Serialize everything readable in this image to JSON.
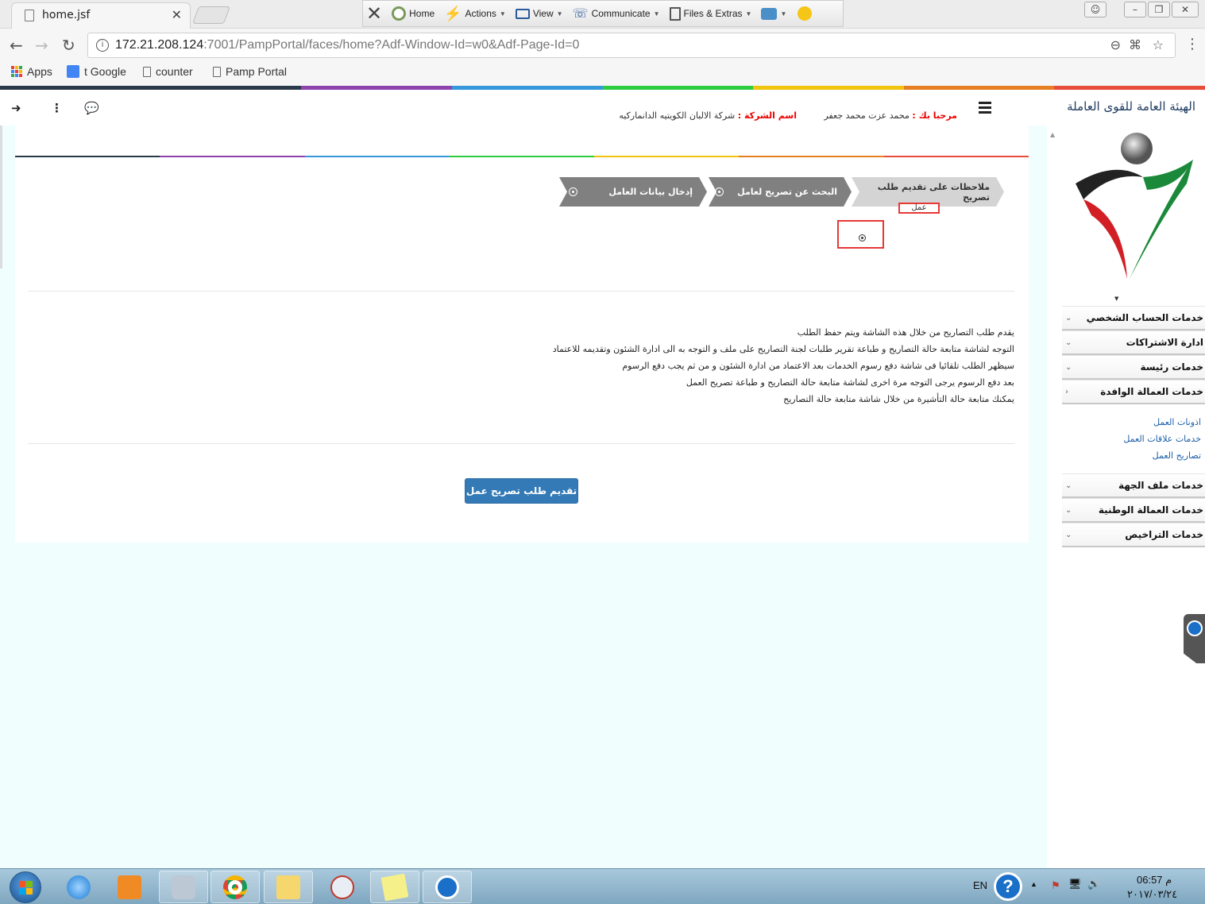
{
  "browser": {
    "tab_title": "home.jsf",
    "url_host": "172.21.208.124",
    "url_path": ":7001/PampPortal/faces/home?Adf-Window-Id=w0&Adf-Page-Id=0",
    "bookmarks": [
      "Apps",
      "t Google",
      "counter",
      "Pamp Portal"
    ]
  },
  "teamviewer": {
    "items": [
      "Home",
      "Actions",
      "View",
      "Communicate",
      "Files & Extras"
    ]
  },
  "header": {
    "welcome_label": "مرحبا بك :",
    "welcome_name": "محمد عزت محمد جعفر",
    "company_label": "اسم الشركة :",
    "company_name": "شركة الالبان الكويتيه الدانماركيه"
  },
  "sidebar": {
    "org_title": "الهيئة العامة للقوى العاملة",
    "menu_top": [
      "خدمات الحساب الشخصي",
      "ادارة الاشتراكات",
      "خدمات رئيسة",
      "خدمات العمالة الوافدة"
    ],
    "submenu": [
      "اذونات العمل",
      "خدمات علاقات العمل",
      "تصاريح العمل"
    ],
    "menu_bottom": [
      "خدمات ملف الجهة",
      "خدمات العمالة الوطنية",
      "خدمات التراخيص"
    ]
  },
  "steps": {
    "step1": "ملاحظات على تقديم طلب تصريح",
    "step1_sub": "عمل",
    "step2": "البحث عن تصريح لعامل",
    "step3": "إدخال بيانات العامل"
  },
  "notes": [
    "يقدم طلب التصاريح من خلال هذه الشاشة ويتم حفظ الطلب",
    "التوجه لشاشة متابعة حالة التصاريح و طباعة تقرير طلبات لجنة التصاريح على ملف و التوجه به الى ادارة الشئون وتقديمه للاعتماد",
    "سيظهر الطلب تلقائيا فى شاشة دفع رسوم الخدمات بعد الاعتماد من ادارة الشئون و من ثم يجب دفع الرسوم",
    "بعد دفع الرسوم يرجى التوجه مرة اخرى لشاشة متابعة حالة التصاريح و طباعة تصريح العمل",
    "يمكنك متابعة حالة التأشيرة من خلال شاشة متابعة حالة التصاريح"
  ],
  "submit_label": "تقديم طلب تصريح عمل",
  "tray": {
    "lang": "EN",
    "time": "06:57 م",
    "date": "٢٠١٧/٠٣/٢٤"
  },
  "colors": {
    "primary_button": "#337ab7",
    "step_gray": "#808080",
    "highlight_red": "#e53935",
    "page_bg": "#f0fefe"
  }
}
